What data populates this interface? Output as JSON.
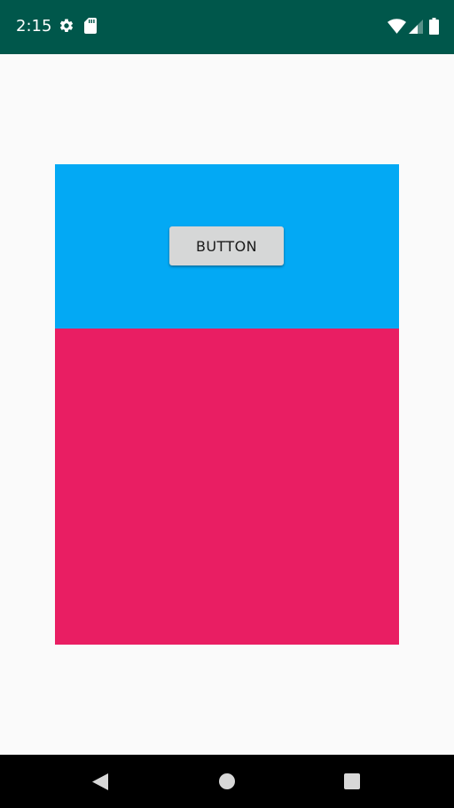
{
  "status_bar": {
    "time": "2:15",
    "background_color": "#00574b",
    "icons": [
      "gear-icon",
      "sd-card-icon",
      "wifi-icon",
      "cell-signal-icon",
      "battery-icon"
    ]
  },
  "main": {
    "background_color": "#fafafa",
    "top_panel_color": "#03a9f4",
    "bottom_panel_color": "#e91e63",
    "button_label": "BUTTON"
  },
  "nav_bar": {
    "background_color": "#000000",
    "icons": [
      "back-icon",
      "home-icon",
      "recents-icon"
    ]
  }
}
